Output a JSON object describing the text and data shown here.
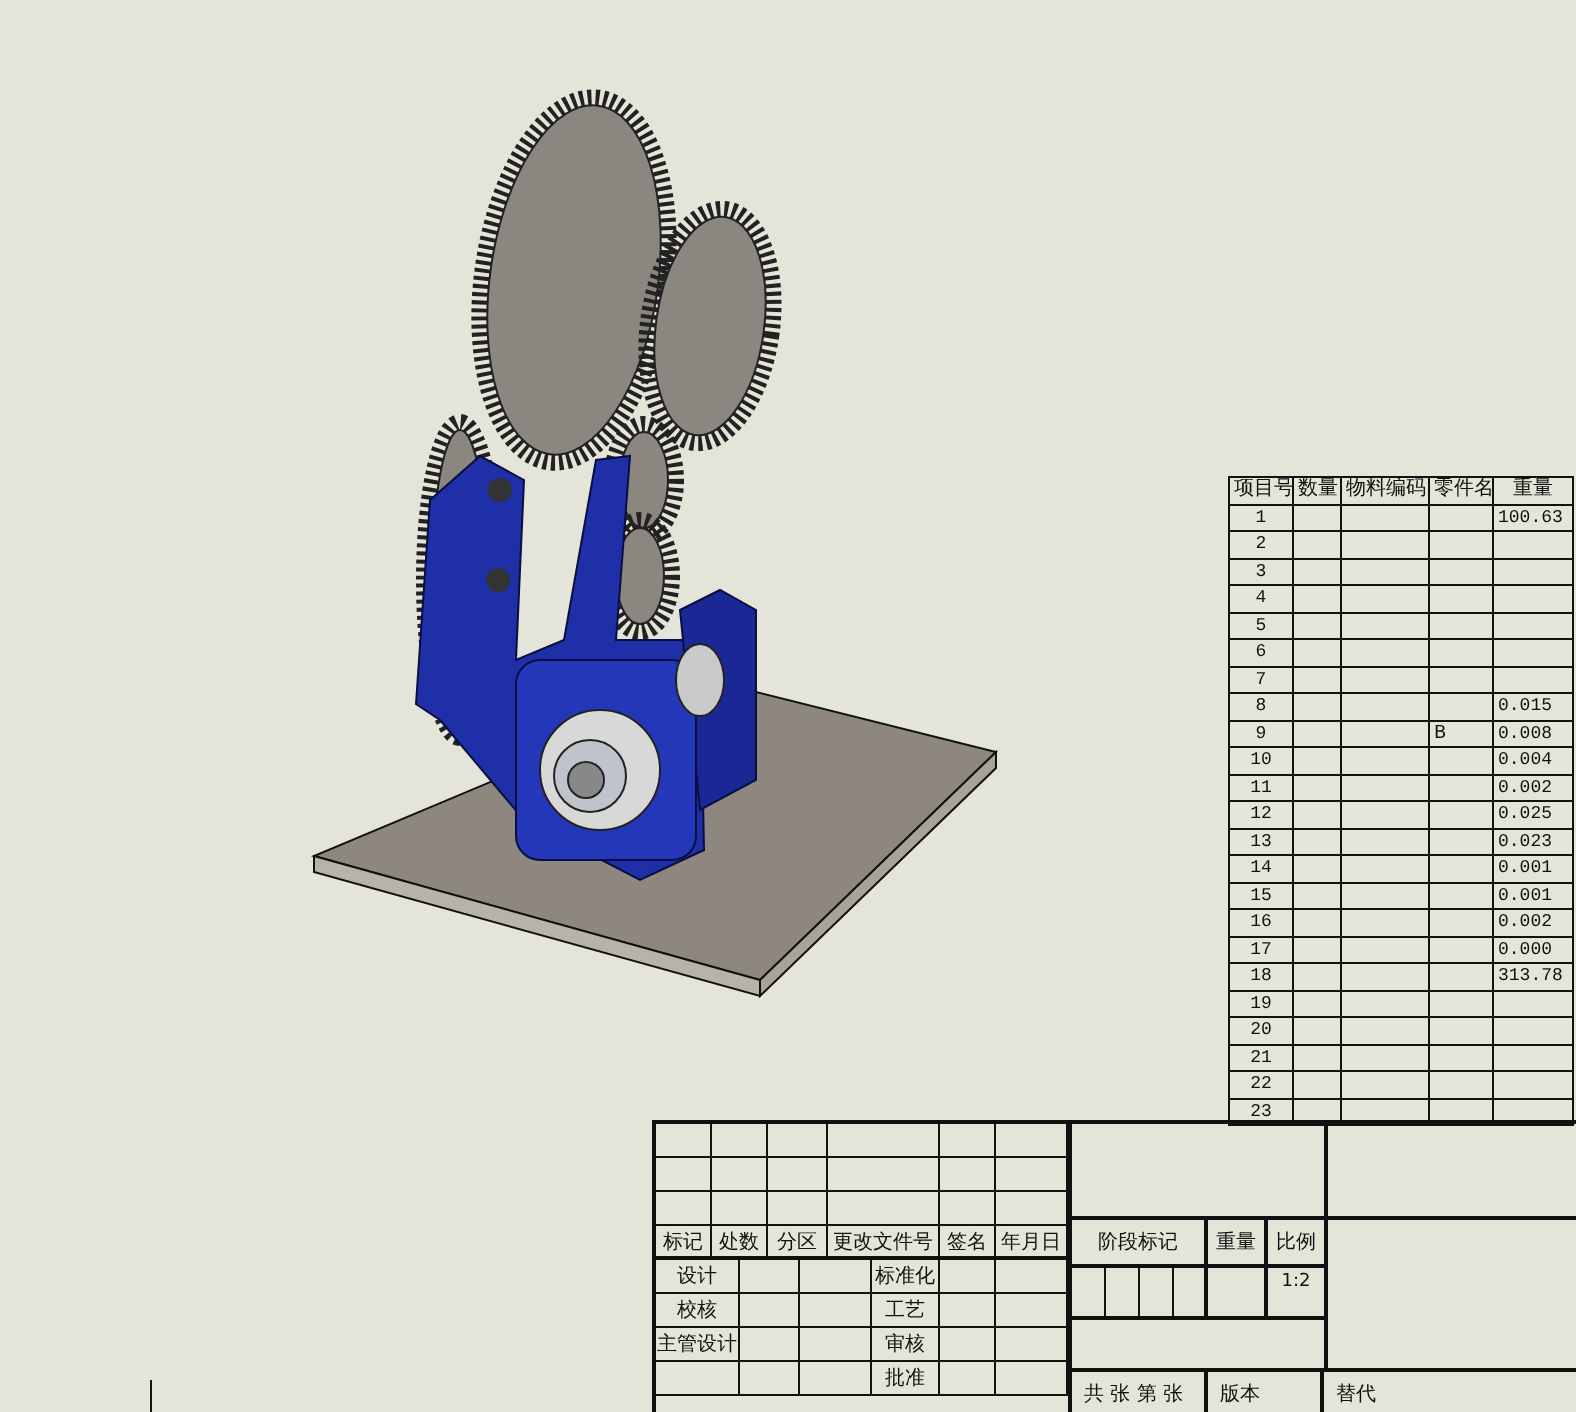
{
  "bom_table": {
    "columns": [
      "项目号",
      "数量",
      "物料编码",
      "零件名",
      "重量"
    ],
    "rows": [
      {
        "item_no": "1",
        "weight": "100.63"
      },
      {
        "item_no": "2"
      },
      {
        "item_no": "3"
      },
      {
        "item_no": "4"
      },
      {
        "item_no": "5"
      },
      {
        "item_no": "6"
      },
      {
        "item_no": "7"
      },
      {
        "item_no": "8",
        "weight": "0.015"
      },
      {
        "item_no": "9",
        "part_name": "B",
        "weight": "0.008"
      },
      {
        "item_no": "10",
        "weight": "0.004"
      },
      {
        "item_no": "11",
        "weight": "0.002"
      },
      {
        "item_no": "12",
        "weight": "0.025"
      },
      {
        "item_no": "13",
        "weight": "0.023"
      },
      {
        "item_no": "14",
        "weight": "0.001"
      },
      {
        "item_no": "15",
        "weight": "0.001"
      },
      {
        "item_no": "16",
        "weight": "0.002"
      },
      {
        "item_no": "17",
        "weight": "0.000"
      },
      {
        "item_no": "18",
        "weight": "313.78"
      },
      {
        "item_no": "19"
      },
      {
        "item_no": "20"
      },
      {
        "item_no": "21"
      },
      {
        "item_no": "22"
      },
      {
        "item_no": "23"
      }
    ]
  },
  "title_block": {
    "revision_headers": [
      "标记",
      "处数",
      "分区",
      "更改文件号",
      "签名",
      "年月日"
    ],
    "sign_rows": [
      {
        "role": "设计",
        "check": "标准化"
      },
      {
        "role": "校核",
        "check": "工艺"
      },
      {
        "role": "主管设计",
        "check": "审核"
      },
      {
        "check": "批准"
      }
    ],
    "stage_mark_label": "阶段标记",
    "weight_label": "重量",
    "scale_label": "比例",
    "scale": "1:2",
    "sheet_label": "共 张 第 张",
    "version_label": "版本",
    "replaces_label": "替代"
  }
}
